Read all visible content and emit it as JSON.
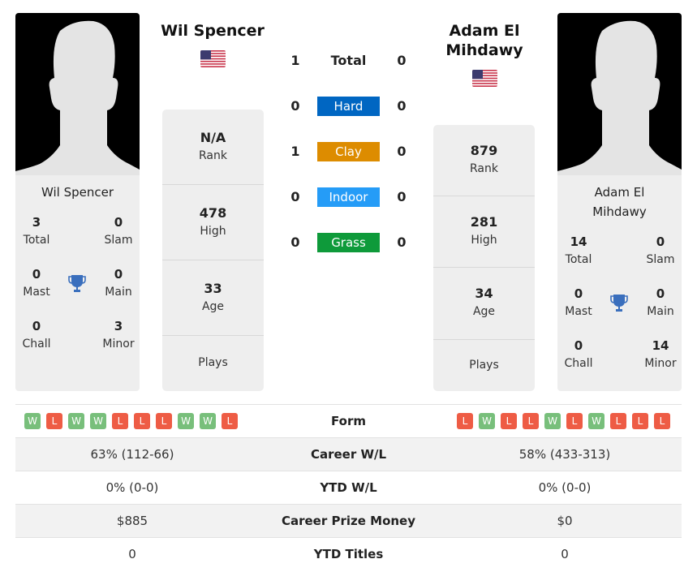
{
  "colors": {
    "hard": "#0066c2",
    "clay": "#dd8c00",
    "indoor": "#259cf7",
    "grass": "#0e9a3a",
    "win": "#78bf7b",
    "loss": "#ee5c45",
    "trophy": "#3a6fbd"
  },
  "player1": {
    "name": "Wil Spencer",
    "card_name": "Wil Spencer",
    "flag": "us-flag",
    "stats": [
      {
        "value": "N/A",
        "label": "Rank"
      },
      {
        "value": "478",
        "label": "High"
      },
      {
        "value": "33",
        "label": "Age"
      },
      {
        "value": "",
        "label": "Plays"
      }
    ],
    "titles": {
      "total": {
        "value": "3",
        "label": "Total"
      },
      "slam": {
        "value": "0",
        "label": "Slam"
      },
      "mast": {
        "value": "0",
        "label": "Mast"
      },
      "main": {
        "value": "0",
        "label": "Main"
      },
      "chall": {
        "value": "0",
        "label": "Chall"
      },
      "minor": {
        "value": "3",
        "label": "Minor"
      }
    },
    "form": [
      "W",
      "L",
      "W",
      "W",
      "L",
      "L",
      "L",
      "W",
      "W",
      "L"
    ]
  },
  "player2": {
    "name": "Adam El Mihdawy",
    "name_line1": "Adam El",
    "name_line2": "Mihdawy",
    "card_name_line1": "Adam El",
    "card_name_line2": "Mihdawy",
    "flag": "us-flag",
    "stats": [
      {
        "value": "879",
        "label": "Rank"
      },
      {
        "value": "281",
        "label": "High"
      },
      {
        "value": "34",
        "label": "Age"
      },
      {
        "value": "",
        "label": "Plays"
      }
    ],
    "titles": {
      "total": {
        "value": "14",
        "label": "Total"
      },
      "slam": {
        "value": "0",
        "label": "Slam"
      },
      "mast": {
        "value": "0",
        "label": "Mast"
      },
      "main": {
        "value": "0",
        "label": "Main"
      },
      "chall": {
        "value": "0",
        "label": "Chall"
      },
      "minor": {
        "value": "14",
        "label": "Minor"
      }
    },
    "form": [
      "L",
      "W",
      "L",
      "L",
      "W",
      "L",
      "W",
      "L",
      "L",
      "L"
    ]
  },
  "h2h": [
    {
      "label": "Total",
      "p1": "1",
      "p2": "0"
    },
    {
      "label": "Hard",
      "p1": "0",
      "p2": "0"
    },
    {
      "label": "Clay",
      "p1": "1",
      "p2": "0"
    },
    {
      "label": "Indoor",
      "p1": "0",
      "p2": "0"
    },
    {
      "label": "Grass",
      "p1": "0",
      "p2": "0"
    }
  ],
  "table": [
    {
      "label": "Form"
    },
    {
      "label": "Career W/L",
      "p1": "63% (112-66)",
      "p2": "58% (433-313)"
    },
    {
      "label": "YTD W/L",
      "p1": "0% (0-0)",
      "p2": "0% (0-0)"
    },
    {
      "label": "Career Prize Money",
      "p1": "$885",
      "p2": "$0"
    },
    {
      "label": "YTD Titles",
      "p1": "0",
      "p2": "0"
    }
  ]
}
